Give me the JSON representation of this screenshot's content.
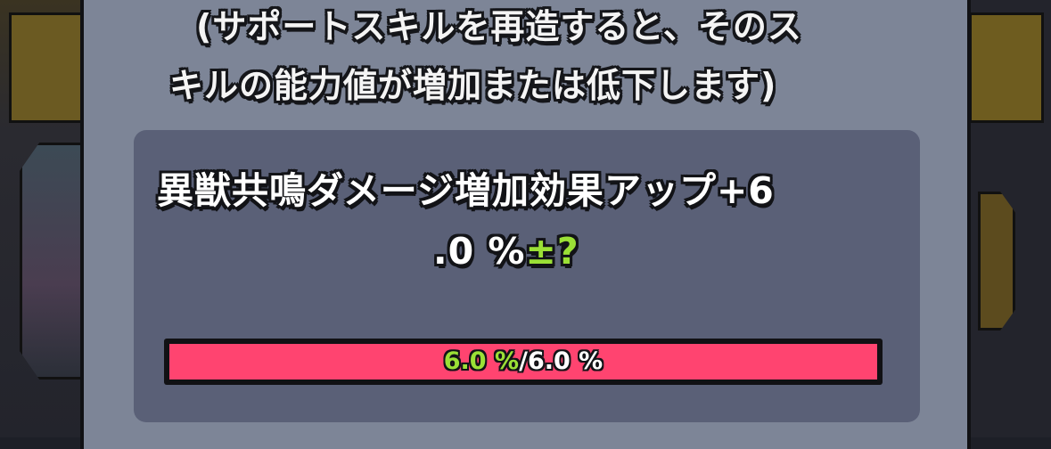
{
  "reforge_note": {
    "line1": "(サポートスキルを再造すると、そのス",
    "line2": "キルの能力値が増加または低下します)"
  },
  "skill_effect": {
    "line1": "異獣共鳴ダメージ増加効果アップ+6",
    "line2_value": ".0 %",
    "line2_variance": "±?"
  },
  "progress": {
    "current_label": "6.0 %",
    "separator": "/",
    "max_label": "6.0 %",
    "fill_fraction": 1.0
  },
  "colors": {
    "dialog_bg": "#7d8597",
    "panel_bg": "#5a6077",
    "bar_fill": "#ff4470",
    "accent_green": "#9be036"
  }
}
